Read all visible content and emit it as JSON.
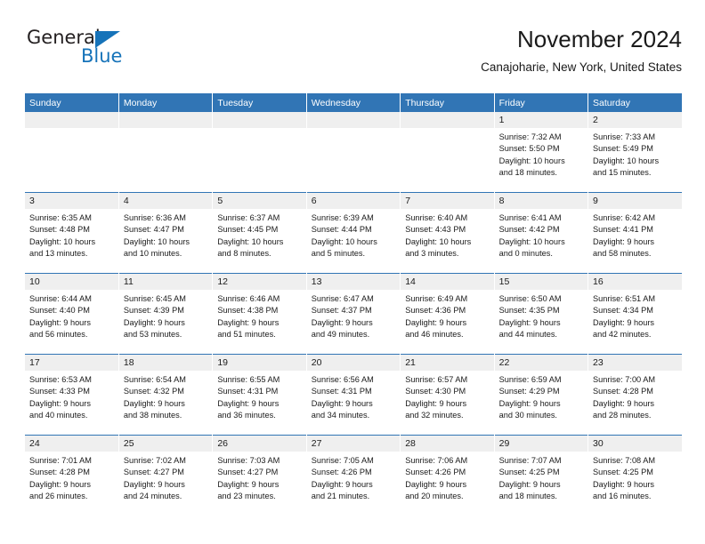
{
  "brand": {
    "name_top": "General",
    "name_bottom": "Blue",
    "triangle_color": "#1673b9",
    "text_color": "#231f20"
  },
  "header": {
    "title": "November 2024",
    "subtitle": "Canajoharie, New York, United States"
  },
  "theme": {
    "header_blue": "#3175b5",
    "daynum_gray": "#efefef",
    "text": "#1a1a1a"
  },
  "weekday_headers": [
    "Sunday",
    "Monday",
    "Tuesday",
    "Wednesday",
    "Thursday",
    "Friday",
    "Saturday"
  ],
  "weeks": [
    [
      {
        "day": "",
        "empty": true
      },
      {
        "day": "",
        "empty": true
      },
      {
        "day": "",
        "empty": true
      },
      {
        "day": "",
        "empty": true
      },
      {
        "day": "",
        "empty": true
      },
      {
        "day": "1",
        "sunrise": "Sunrise: 7:32 AM",
        "sunset": "Sunset: 5:50 PM",
        "daylight1": "Daylight: 10 hours",
        "daylight2": "and 18 minutes."
      },
      {
        "day": "2",
        "sunrise": "Sunrise: 7:33 AM",
        "sunset": "Sunset: 5:49 PM",
        "daylight1": "Daylight: 10 hours",
        "daylight2": "and 15 minutes."
      }
    ],
    [
      {
        "day": "3",
        "sunrise": "Sunrise: 6:35 AM",
        "sunset": "Sunset: 4:48 PM",
        "daylight1": "Daylight: 10 hours",
        "daylight2": "and 13 minutes."
      },
      {
        "day": "4",
        "sunrise": "Sunrise: 6:36 AM",
        "sunset": "Sunset: 4:47 PM",
        "daylight1": "Daylight: 10 hours",
        "daylight2": "and 10 minutes."
      },
      {
        "day": "5",
        "sunrise": "Sunrise: 6:37 AM",
        "sunset": "Sunset: 4:45 PM",
        "daylight1": "Daylight: 10 hours",
        "daylight2": "and 8 minutes."
      },
      {
        "day": "6",
        "sunrise": "Sunrise: 6:39 AM",
        "sunset": "Sunset: 4:44 PM",
        "daylight1": "Daylight: 10 hours",
        "daylight2": "and 5 minutes."
      },
      {
        "day": "7",
        "sunrise": "Sunrise: 6:40 AM",
        "sunset": "Sunset: 4:43 PM",
        "daylight1": "Daylight: 10 hours",
        "daylight2": "and 3 minutes."
      },
      {
        "day": "8",
        "sunrise": "Sunrise: 6:41 AM",
        "sunset": "Sunset: 4:42 PM",
        "daylight1": "Daylight: 10 hours",
        "daylight2": "and 0 minutes."
      },
      {
        "day": "9",
        "sunrise": "Sunrise: 6:42 AM",
        "sunset": "Sunset: 4:41 PM",
        "daylight1": "Daylight: 9 hours",
        "daylight2": "and 58 minutes."
      }
    ],
    [
      {
        "day": "10",
        "sunrise": "Sunrise: 6:44 AM",
        "sunset": "Sunset: 4:40 PM",
        "daylight1": "Daylight: 9 hours",
        "daylight2": "and 56 minutes."
      },
      {
        "day": "11",
        "sunrise": "Sunrise: 6:45 AM",
        "sunset": "Sunset: 4:39 PM",
        "daylight1": "Daylight: 9 hours",
        "daylight2": "and 53 minutes."
      },
      {
        "day": "12",
        "sunrise": "Sunrise: 6:46 AM",
        "sunset": "Sunset: 4:38 PM",
        "daylight1": "Daylight: 9 hours",
        "daylight2": "and 51 minutes."
      },
      {
        "day": "13",
        "sunrise": "Sunrise: 6:47 AM",
        "sunset": "Sunset: 4:37 PM",
        "daylight1": "Daylight: 9 hours",
        "daylight2": "and 49 minutes."
      },
      {
        "day": "14",
        "sunrise": "Sunrise: 6:49 AM",
        "sunset": "Sunset: 4:36 PM",
        "daylight1": "Daylight: 9 hours",
        "daylight2": "and 46 minutes."
      },
      {
        "day": "15",
        "sunrise": "Sunrise: 6:50 AM",
        "sunset": "Sunset: 4:35 PM",
        "daylight1": "Daylight: 9 hours",
        "daylight2": "and 44 minutes."
      },
      {
        "day": "16",
        "sunrise": "Sunrise: 6:51 AM",
        "sunset": "Sunset: 4:34 PM",
        "daylight1": "Daylight: 9 hours",
        "daylight2": "and 42 minutes."
      }
    ],
    [
      {
        "day": "17",
        "sunrise": "Sunrise: 6:53 AM",
        "sunset": "Sunset: 4:33 PM",
        "daylight1": "Daylight: 9 hours",
        "daylight2": "and 40 minutes."
      },
      {
        "day": "18",
        "sunrise": "Sunrise: 6:54 AM",
        "sunset": "Sunset: 4:32 PM",
        "daylight1": "Daylight: 9 hours",
        "daylight2": "and 38 minutes."
      },
      {
        "day": "19",
        "sunrise": "Sunrise: 6:55 AM",
        "sunset": "Sunset: 4:31 PM",
        "daylight1": "Daylight: 9 hours",
        "daylight2": "and 36 minutes."
      },
      {
        "day": "20",
        "sunrise": "Sunrise: 6:56 AM",
        "sunset": "Sunset: 4:31 PM",
        "daylight1": "Daylight: 9 hours",
        "daylight2": "and 34 minutes."
      },
      {
        "day": "21",
        "sunrise": "Sunrise: 6:57 AM",
        "sunset": "Sunset: 4:30 PM",
        "daylight1": "Daylight: 9 hours",
        "daylight2": "and 32 minutes."
      },
      {
        "day": "22",
        "sunrise": "Sunrise: 6:59 AM",
        "sunset": "Sunset: 4:29 PM",
        "daylight1": "Daylight: 9 hours",
        "daylight2": "and 30 minutes."
      },
      {
        "day": "23",
        "sunrise": "Sunrise: 7:00 AM",
        "sunset": "Sunset: 4:28 PM",
        "daylight1": "Daylight: 9 hours",
        "daylight2": "and 28 minutes."
      }
    ],
    [
      {
        "day": "24",
        "sunrise": "Sunrise: 7:01 AM",
        "sunset": "Sunset: 4:28 PM",
        "daylight1": "Daylight: 9 hours",
        "daylight2": "and 26 minutes."
      },
      {
        "day": "25",
        "sunrise": "Sunrise: 7:02 AM",
        "sunset": "Sunset: 4:27 PM",
        "daylight1": "Daylight: 9 hours",
        "daylight2": "and 24 minutes."
      },
      {
        "day": "26",
        "sunrise": "Sunrise: 7:03 AM",
        "sunset": "Sunset: 4:27 PM",
        "daylight1": "Daylight: 9 hours",
        "daylight2": "and 23 minutes."
      },
      {
        "day": "27",
        "sunrise": "Sunrise: 7:05 AM",
        "sunset": "Sunset: 4:26 PM",
        "daylight1": "Daylight: 9 hours",
        "daylight2": "and 21 minutes."
      },
      {
        "day": "28",
        "sunrise": "Sunrise: 7:06 AM",
        "sunset": "Sunset: 4:26 PM",
        "daylight1": "Daylight: 9 hours",
        "daylight2": "and 20 minutes."
      },
      {
        "day": "29",
        "sunrise": "Sunrise: 7:07 AM",
        "sunset": "Sunset: 4:25 PM",
        "daylight1": "Daylight: 9 hours",
        "daylight2": "and 18 minutes."
      },
      {
        "day": "30",
        "sunrise": "Sunrise: 7:08 AM",
        "sunset": "Sunset: 4:25 PM",
        "daylight1": "Daylight: 9 hours",
        "daylight2": "and 16 minutes."
      }
    ]
  ]
}
